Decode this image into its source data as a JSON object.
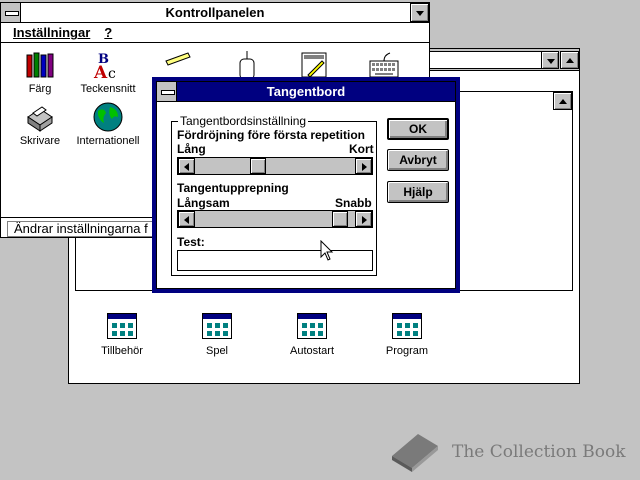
{
  "control_panel": {
    "title": "Kontrollpanelen",
    "menu": [
      "Inställningar",
      "?"
    ],
    "icons": [
      {
        "label": "Färg",
        "icon": "crayons-icon"
      },
      {
        "label": "Teckensnitt",
        "icon": "fonts-icon"
      },
      {
        "label": "",
        "icon": "ports-icon"
      },
      {
        "label": "",
        "icon": "mouse-icon"
      },
      {
        "label": "",
        "icon": "desktop-icon"
      },
      {
        "label": "",
        "icon": "keyboard-icon"
      },
      {
        "label": "Skrivare",
        "icon": "printer-icon"
      },
      {
        "label": "Internationell",
        "icon": "globe-icon"
      }
    ],
    "status": "Ändrar inställningarna f"
  },
  "program_manager": {
    "groups": [
      {
        "label": "Tillbehör"
      },
      {
        "label": "Spel"
      },
      {
        "label": "Autostart"
      },
      {
        "label": "Program"
      }
    ]
  },
  "dialog": {
    "title": "Tangentbord",
    "group_label": "Tangentbordsinställning",
    "delay_label": "Fördröjning före första repetition",
    "delay_min": "Lång",
    "delay_max": "Kort",
    "delay_value": 0.38,
    "rate_label": "Tangentupprepning",
    "rate_min": "Långsam",
    "rate_max": "Snabb",
    "rate_value": 0.95,
    "test_label": "Test:",
    "test_value": "",
    "ok_label": "OK",
    "cancel_label": "Avbryt",
    "help_label": "Hjälp"
  },
  "watermark": "The Collection Book",
  "colors": {
    "active_title": "#000080",
    "face": "#c3c3c3",
    "desktop": "#c3c3c3"
  }
}
